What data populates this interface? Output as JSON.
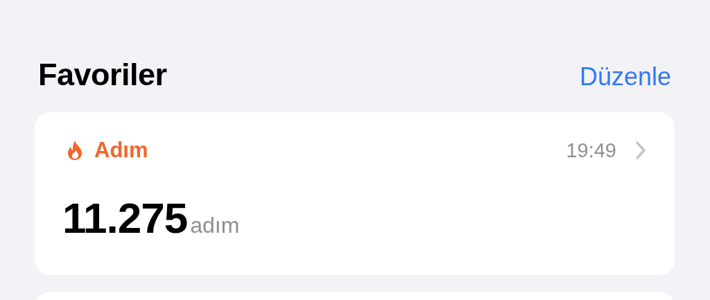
{
  "section": {
    "title": "Favoriler",
    "edit_link": "Düzenle"
  },
  "cards": [
    {
      "title": "Adım",
      "time": "19:49",
      "value": "11.275",
      "unit": "adım",
      "color": "#f1672b"
    }
  ]
}
